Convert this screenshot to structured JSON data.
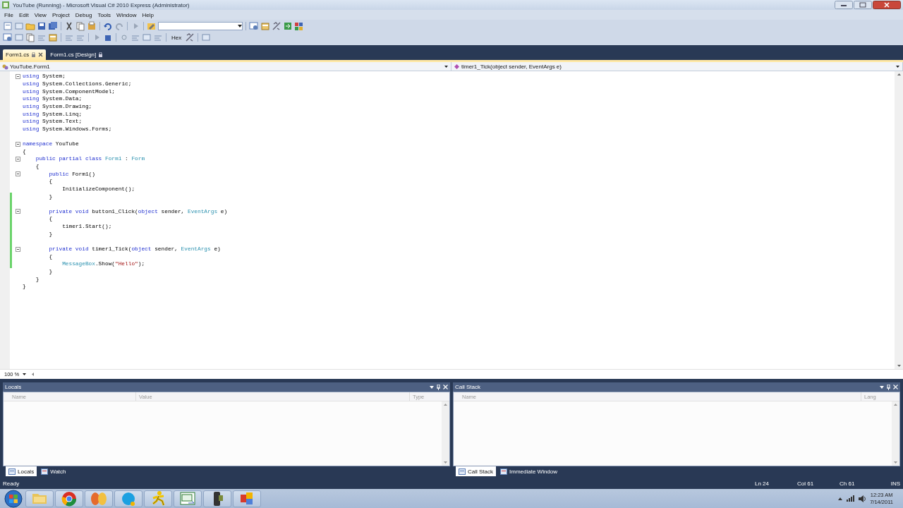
{
  "window": {
    "title": "YouTube (Running) - Microsoft Visual C# 2010 Express (Administrator)"
  },
  "menu": [
    "File",
    "Edit",
    "View",
    "Project",
    "Debug",
    "Tools",
    "Window",
    "Help"
  ],
  "toolbar": {
    "hex_button": "Hex"
  },
  "document_tabs": [
    {
      "label": "Form1.cs",
      "selected": true
    },
    {
      "label": "Form1.cs [Design]",
      "selected": false
    }
  ],
  "navigation": {
    "type_selector": "YouTube.Form1",
    "member_selector": "timer1_Tick(object sender, EventArgs e)"
  },
  "code": {
    "lines": [
      {
        "fold": true,
        "changed": false,
        "tokens": [
          {
            "kind": "kw",
            "text": "using"
          },
          {
            "kind": "plain",
            "text": " System;"
          }
        ]
      },
      {
        "fold": false,
        "changed": false,
        "tokens": [
          {
            "kind": "kw",
            "text": "using"
          },
          {
            "kind": "plain",
            "text": " System.Collections.Generic;"
          }
        ]
      },
      {
        "fold": false,
        "changed": false,
        "tokens": [
          {
            "kind": "kw",
            "text": "using"
          },
          {
            "kind": "plain",
            "text": " System.ComponentModel;"
          }
        ]
      },
      {
        "fold": false,
        "changed": false,
        "tokens": [
          {
            "kind": "kw",
            "text": "using"
          },
          {
            "kind": "plain",
            "text": " System.Data;"
          }
        ]
      },
      {
        "fold": false,
        "changed": false,
        "tokens": [
          {
            "kind": "kw",
            "text": "using"
          },
          {
            "kind": "plain",
            "text": " System.Drawing;"
          }
        ]
      },
      {
        "fold": false,
        "changed": false,
        "tokens": [
          {
            "kind": "kw",
            "text": "using"
          },
          {
            "kind": "plain",
            "text": " System.Linq;"
          }
        ]
      },
      {
        "fold": false,
        "changed": false,
        "tokens": [
          {
            "kind": "kw",
            "text": "using"
          },
          {
            "kind": "plain",
            "text": " System.Text;"
          }
        ]
      },
      {
        "fold": false,
        "changed": false,
        "tokens": [
          {
            "kind": "kw",
            "text": "using"
          },
          {
            "kind": "plain",
            "text": " System.Windows.Forms;"
          }
        ]
      },
      {
        "fold": false,
        "changed": false
      },
      {
        "fold": true,
        "changed": false,
        "tokens": [
          {
            "kind": "kw",
            "text": "namespace"
          },
          {
            "kind": "plain",
            "text": " YouTube"
          }
        ]
      },
      {
        "fold": false,
        "changed": false,
        "tokens": [
          {
            "kind": "plain",
            "text": "{"
          }
        ]
      },
      {
        "fold": true,
        "changed": false,
        "tokens": [
          {
            "kind": "kw",
            "text": "    public partial class "
          },
          {
            "kind": "type",
            "text": "Form1"
          },
          {
            "kind": "plain",
            "text": " : "
          },
          {
            "kind": "type",
            "text": "Form"
          }
        ]
      },
      {
        "fold": false,
        "changed": false,
        "tokens": [
          {
            "kind": "plain",
            "text": "    {"
          }
        ]
      },
      {
        "fold": true,
        "changed": false,
        "tokens": [
          {
            "kind": "kw",
            "text": "        public"
          },
          {
            "kind": "plain",
            "text": " Form1()"
          }
        ]
      },
      {
        "fold": false,
        "changed": false,
        "tokens": [
          {
            "kind": "plain",
            "text": "        {"
          }
        ]
      },
      {
        "fold": false,
        "changed": false,
        "tokens": [
          {
            "kind": "plain",
            "text": "            InitializeComponent();"
          }
        ]
      },
      {
        "fold": false,
        "changed": true,
        "tokens": [
          {
            "kind": "plain",
            "text": "        }"
          }
        ]
      },
      {
        "fold": false,
        "changed": true
      },
      {
        "fold": true,
        "changed": true,
        "tokens": [
          {
            "kind": "kw",
            "text": "        private void"
          },
          {
            "kind": "plain",
            "text": " button1_Click("
          },
          {
            "kind": "kw",
            "text": "object"
          },
          {
            "kind": "plain",
            "text": " sender, "
          },
          {
            "kind": "type",
            "text": "EventArgs"
          },
          {
            "kind": "plain",
            "text": " e)"
          }
        ]
      },
      {
        "fold": false,
        "changed": true,
        "tokens": [
          {
            "kind": "plain",
            "text": "        {"
          }
        ]
      },
      {
        "fold": false,
        "changed": true,
        "tokens": [
          {
            "kind": "plain",
            "text": "            timer1.Start();"
          }
        ]
      },
      {
        "fold": false,
        "changed": true,
        "tokens": [
          {
            "kind": "plain",
            "text": "        }"
          }
        ]
      },
      {
        "fold": false,
        "changed": true
      },
      {
        "fold": true,
        "changed": true,
        "tokens": [
          {
            "kind": "kw",
            "text": "        private void"
          },
          {
            "kind": "plain",
            "text": " timer1_Tick("
          },
          {
            "kind": "kw",
            "text": "object"
          },
          {
            "kind": "plain",
            "text": " sender, "
          },
          {
            "kind": "type",
            "text": "EventArgs"
          },
          {
            "kind": "plain",
            "text": " e)"
          }
        ]
      },
      {
        "fold": false,
        "changed": true,
        "tokens": [
          {
            "kind": "plain",
            "text": "        {"
          }
        ]
      },
      {
        "fold": false,
        "changed": true,
        "tokens": [
          {
            "kind": "type",
            "text": "            MessageBox"
          },
          {
            "kind": "plain",
            "text": ".Show("
          },
          {
            "kind": "str",
            "text": "\"Hello\""
          },
          {
            "kind": "plain",
            "text": ");"
          }
        ]
      },
      {
        "fold": false,
        "changed": false,
        "tokens": [
          {
            "kind": "plain",
            "text": "        }"
          }
        ]
      },
      {
        "fold": false,
        "changed": false,
        "tokens": [
          {
            "kind": "plain",
            "text": "    }"
          }
        ]
      },
      {
        "fold": false,
        "changed": false,
        "tokens": [
          {
            "kind": "plain",
            "text": "}"
          }
        ]
      }
    ]
  },
  "zoom": "100 %",
  "panels": [
    {
      "title": "Locals",
      "columns": [
        "Name",
        "Value",
        "Type"
      ],
      "tabs": [
        {
          "label": "Locals",
          "selected": true
        },
        {
          "label": "Watch",
          "selected": false
        }
      ]
    },
    {
      "title": "Call Stack",
      "columns": [
        "Name",
        "Lang"
      ],
      "tabs": [
        {
          "label": "Call Stack",
          "selected": true
        },
        {
          "label": "Immediate Window",
          "selected": false
        }
      ]
    }
  ],
  "status_bar": {
    "message": "Ready",
    "line": "Ln 24",
    "column": "Col 61",
    "char": "Ch 61",
    "mode": "INS"
  },
  "taskbar": {
    "time": "12:23 AM",
    "date": "7/14/2011"
  }
}
